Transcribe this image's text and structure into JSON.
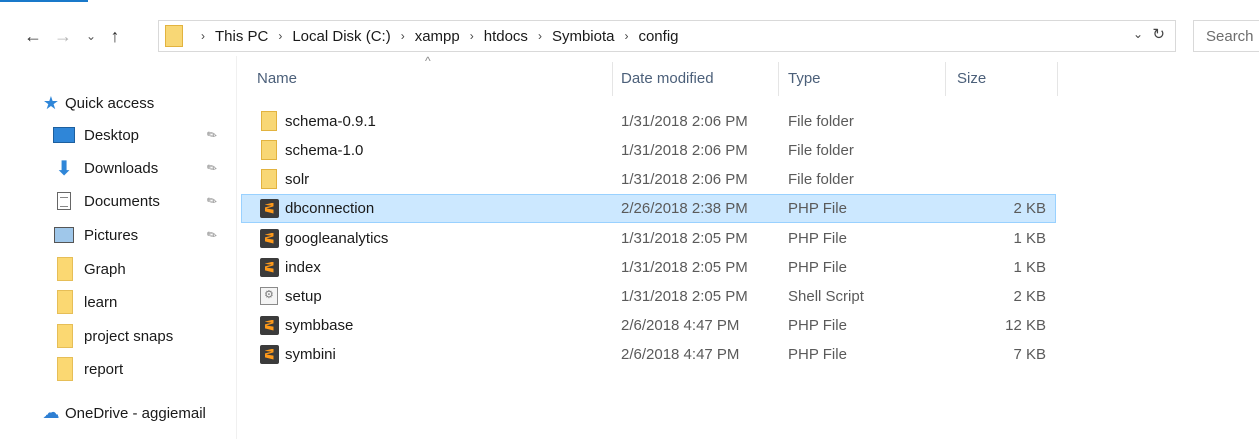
{
  "address_bar": {
    "back": "←",
    "forward": "→",
    "recent": "⌄",
    "up": "↑",
    "crumbs": [
      "This PC",
      "Local Disk (C:)",
      "xampp",
      "htdocs",
      "Symbiota",
      "config"
    ],
    "separator": "›",
    "dropdown": "⌄",
    "refresh": "↻"
  },
  "search": {
    "placeholder": "Search"
  },
  "sidebar": {
    "quick_access": "Quick access",
    "items": [
      {
        "label": "Desktop",
        "pinned": true,
        "icon": "desktop-icon"
      },
      {
        "label": "Downloads",
        "pinned": true,
        "icon": "downloads-icon"
      },
      {
        "label": "Documents",
        "pinned": true,
        "icon": "documents-icon"
      },
      {
        "label": "Pictures",
        "pinned": true,
        "icon": "pictures-icon"
      },
      {
        "label": "Graph",
        "pinned": false,
        "icon": "folder-icon"
      },
      {
        "label": "learn",
        "pinned": false,
        "icon": "folder-icon"
      },
      {
        "label": "project snaps",
        "pinned": false,
        "icon": "folder-icon"
      },
      {
        "label": "report",
        "pinned": false,
        "icon": "folder-icon"
      }
    ],
    "onedrive": "OneDrive - aggiemail",
    "pin_glyph": "📌"
  },
  "columns": {
    "name": "Name",
    "date": "Date modified",
    "type": "Type",
    "size": "Size",
    "sort_glyph": "^"
  },
  "files": [
    {
      "name": "schema-0.9.1",
      "date": "1/31/2018 2:06 PM",
      "type": "File folder",
      "size": "",
      "icon": "folder-icon"
    },
    {
      "name": "schema-1.0",
      "date": "1/31/2018 2:06 PM",
      "type": "File folder",
      "size": "",
      "icon": "folder-icon"
    },
    {
      "name": "solr",
      "date": "1/31/2018 2:06 PM",
      "type": "File folder",
      "size": "",
      "icon": "folder-icon"
    },
    {
      "name": "dbconnection",
      "date": "2/26/2018 2:38 PM",
      "type": "PHP File",
      "size": "2 KB",
      "icon": "php-file-icon",
      "selected": true
    },
    {
      "name": "googleanalytics",
      "date": "1/31/2018 2:05 PM",
      "type": "PHP File",
      "size": "1 KB",
      "icon": "php-file-icon"
    },
    {
      "name": "index",
      "date": "1/31/2018 2:05 PM",
      "type": "PHP File",
      "size": "1 KB",
      "icon": "php-file-icon"
    },
    {
      "name": "setup",
      "date": "1/31/2018 2:05 PM",
      "type": "Shell Script",
      "size": "2 KB",
      "icon": "script-icon"
    },
    {
      "name": "symbbase",
      "date": "2/6/2018 4:47 PM",
      "type": "PHP File",
      "size": "12 KB",
      "icon": "php-file-icon"
    },
    {
      "name": "symbini",
      "date": "2/6/2018 4:47 PM",
      "type": "PHP File",
      "size": "7 KB",
      "icon": "php-file-icon"
    }
  ],
  "colors": {
    "accent": "#1979ca",
    "selected_bg": "#cce8ff",
    "selected_border": "#99d1ff",
    "header_text": "#4c607a"
  }
}
